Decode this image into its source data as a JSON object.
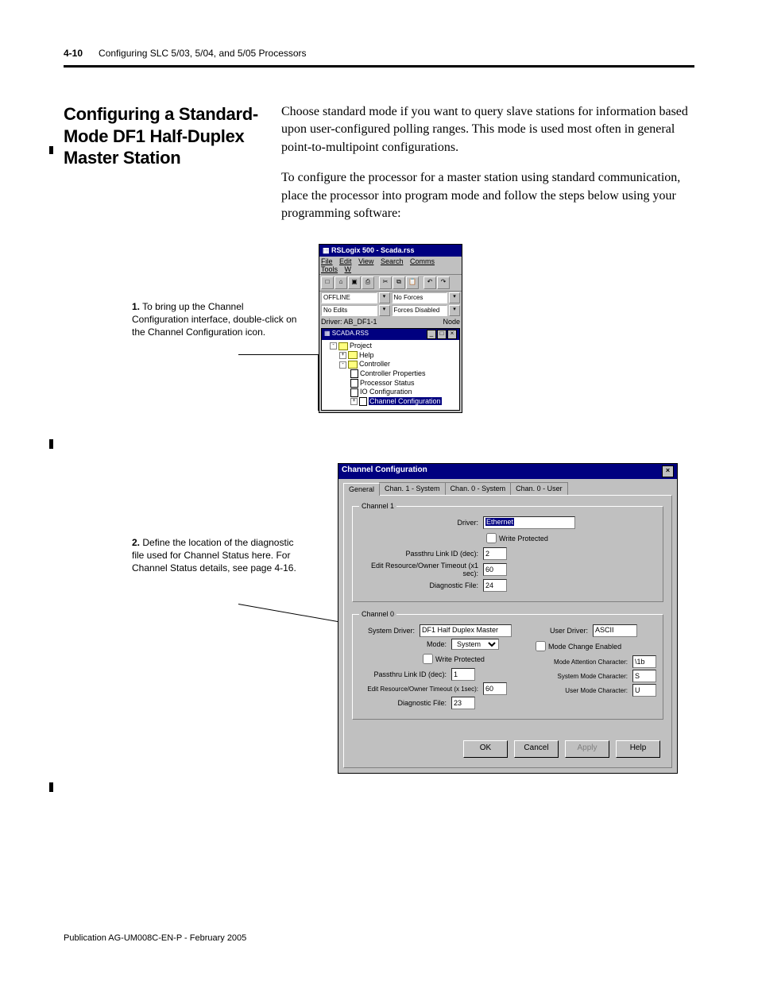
{
  "header": {
    "page_number": "4-10",
    "chapter_title": "Configuring SLC 5/03, 5/04, and 5/05 Processors"
  },
  "heading": "Configuring a Standard-Mode DF1 Half-Duplex Master Station",
  "paragraphs": {
    "p1": "Choose standard mode if you want to query slave stations for information based upon user-configured polling ranges. This mode is used most often in general point-to-multipoint configurations.",
    "p2": "To configure the processor for a master station using standard communication, place the processor into program mode and follow the steps below using your programming software:"
  },
  "callouts": {
    "c1_num": "1.",
    "c1_text": "To bring up the Channel Configuration interface, double-click on the Channel Configuration icon.",
    "c2_num": "2.",
    "c2_text": "Define the location of the diagnostic file used for Channel Status here. For Channel Status details, see page 4-16."
  },
  "rslogix": {
    "title": "RSLogix 500 - Scada.rss",
    "menu": [
      "File",
      "Edit",
      "View",
      "Search",
      "Comms",
      "Tools",
      "W"
    ],
    "status": {
      "offline": "OFFLINE",
      "no_forces": "No Forces",
      "no_edits": "No Edits",
      "forces_disabled": "Forces Disabled",
      "driver_line": "Driver: AB_DF1-1",
      "node": "Node"
    },
    "dock_title": "SCADA.RSS",
    "tree": {
      "project": "Project",
      "help": "Help",
      "controller": "Controller",
      "controller_props": "Controller Properties",
      "processor_status": "Processor Status",
      "io_config": "IO Configuration",
      "channel_config": "Channel Configuration"
    }
  },
  "chancfg": {
    "title": "Channel Configuration",
    "tabs": [
      "General",
      "Chan. 1 - System",
      "Chan. 0 - System",
      "Chan. 0 - User"
    ],
    "ch1": {
      "legend": "Channel 1",
      "driver_label": "Driver:",
      "driver_value": "Ethernet",
      "write_protected": "Write Protected",
      "passthru_label": "Passthru Link ID (dec):",
      "passthru_value": "2",
      "timeout_label": "Edit Resource/Owner Timeout (x1 sec):",
      "timeout_value": "60",
      "diag_label": "Diagnostic File:",
      "diag_value": "24"
    },
    "ch0": {
      "legend": "Channel 0",
      "sys_driver_label": "System Driver:",
      "sys_driver_value": "DF1 Half Duplex Master",
      "mode_label": "Mode:",
      "mode_value": "System",
      "write_protected": "Write Protected",
      "passthru_label": "Passthru Link ID (dec):",
      "passthru_value": "1",
      "timeout_label": "Edit Resource/Owner Timeout (x 1sec):",
      "timeout_value": "60",
      "diag_label": "Diagnostic File:",
      "diag_value": "23",
      "user_driver_label": "User Driver:",
      "user_driver_value": "ASCII",
      "mode_change_label": "Mode Change Enabled",
      "mode_attn_label": "Mode Attention Character:",
      "mode_attn_value": "\\1b",
      "sys_mode_char_label": "System Mode Character:",
      "sys_mode_char_value": "S",
      "user_mode_char_label": "User Mode Character:",
      "user_mode_char_value": "U"
    },
    "buttons": {
      "ok": "OK",
      "cancel": "Cancel",
      "apply": "Apply",
      "help": "Help"
    }
  },
  "footer": "Publication AG-UM008C-EN-P - February 2005"
}
